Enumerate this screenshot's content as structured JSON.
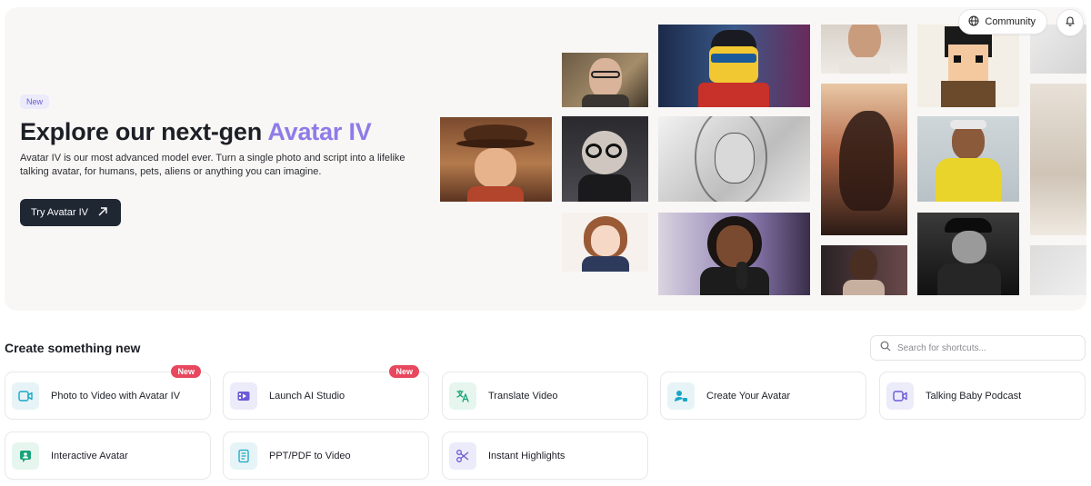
{
  "header": {
    "community_label": "Community",
    "icons": [
      "globe-icon",
      "bell-icon"
    ]
  },
  "hero": {
    "badge": "New",
    "title_prefix": "Explore our next-gen ",
    "title_accent": "Avatar IV",
    "description": "Avatar IV is our most advanced model ever. Turn a single photo and script into a lifelike talking avatar, for humans, pets, aliens or anything you can imagine.",
    "cta_label": "Try Avatar IV",
    "accent_color": "#8e7ce8"
  },
  "create": {
    "title": "Create something new",
    "search_placeholder": "Search for shortcuts...",
    "badge_new": "New",
    "cards": [
      {
        "label": "Photo to Video with Avatar IV",
        "icon": "video-camera-icon",
        "badge": "New"
      },
      {
        "label": "Launch AI Studio",
        "icon": "film-icon",
        "badge": "New"
      },
      {
        "label": "Translate Video",
        "icon": "translate-icon",
        "badge": ""
      },
      {
        "label": "Create Your Avatar",
        "icon": "avatar-create-icon",
        "badge": ""
      },
      {
        "label": "Talking Baby Podcast",
        "icon": "video-camera-icon",
        "badge": ""
      },
      {
        "label": "Interactive Avatar",
        "icon": "chat-avatar-icon",
        "badge": ""
      },
      {
        "label": "PPT/PDF to Video",
        "icon": "document-icon",
        "badge": ""
      },
      {
        "label": "Instant Highlights",
        "icon": "scissors-icon",
        "badge": ""
      }
    ]
  }
}
